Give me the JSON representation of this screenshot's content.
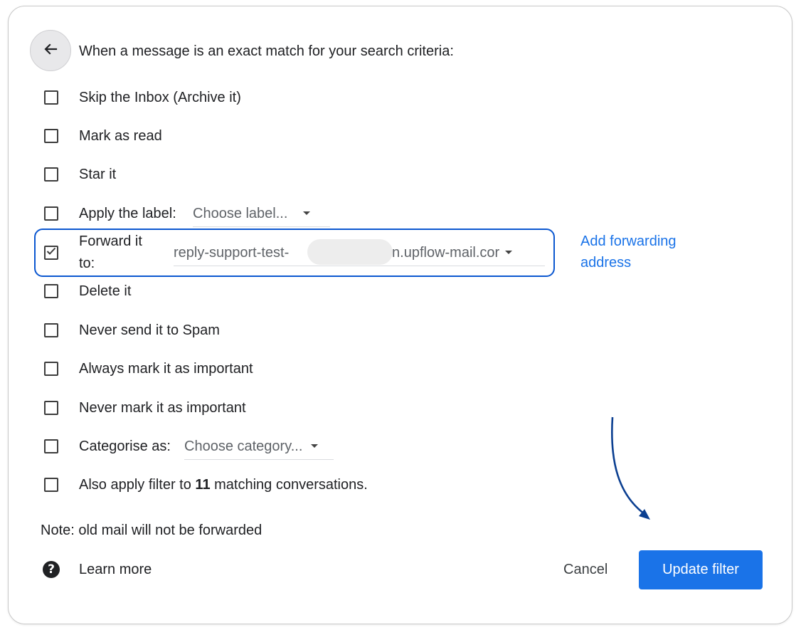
{
  "header": {
    "text": "When a message is an exact match for your search criteria:"
  },
  "options": [
    {
      "label": "Skip the Inbox (Archive it)",
      "checked": false
    },
    {
      "label": "Mark as read",
      "checked": false
    },
    {
      "label": "Star it",
      "checked": false
    },
    {
      "label": "Apply the label:",
      "checked": false,
      "select_value": "Choose label..."
    },
    {
      "label_line1": "Forward it",
      "label_line2": "to:",
      "checked": true,
      "address_prefix": "reply-support-test-",
      "address_suffix": "@in.upflow-mail.cor"
    },
    {
      "label": "Delete it",
      "checked": false
    },
    {
      "label": "Never send it to Spam",
      "checked": false
    },
    {
      "label": "Always mark it as important",
      "checked": false
    },
    {
      "label": "Never mark it as important",
      "checked": false
    },
    {
      "label": "Categorise as:",
      "checked": false,
      "select_value": "Choose category..."
    },
    {
      "label_prefix": "Also apply filter to ",
      "count": "11",
      "label_suffix": " matching conversations.",
      "checked": false
    }
  ],
  "add_forwarding": {
    "line1": "Add forwarding",
    "line2": "address"
  },
  "note": "Note: old mail will not be forwarded",
  "learn_more": "Learn more",
  "help_glyph": "?",
  "cancel_label": "Cancel",
  "update_label": "Update filter",
  "colors": {
    "accent": "#1a73e8",
    "highlight_border": "#0b57d0",
    "annotation_arrow": "#0b3f91"
  },
  "icons": {
    "back": "arrow-left-icon",
    "help": "help-circle-icon",
    "checkbox_checked": "check-icon",
    "caret": "caret-down-icon"
  }
}
